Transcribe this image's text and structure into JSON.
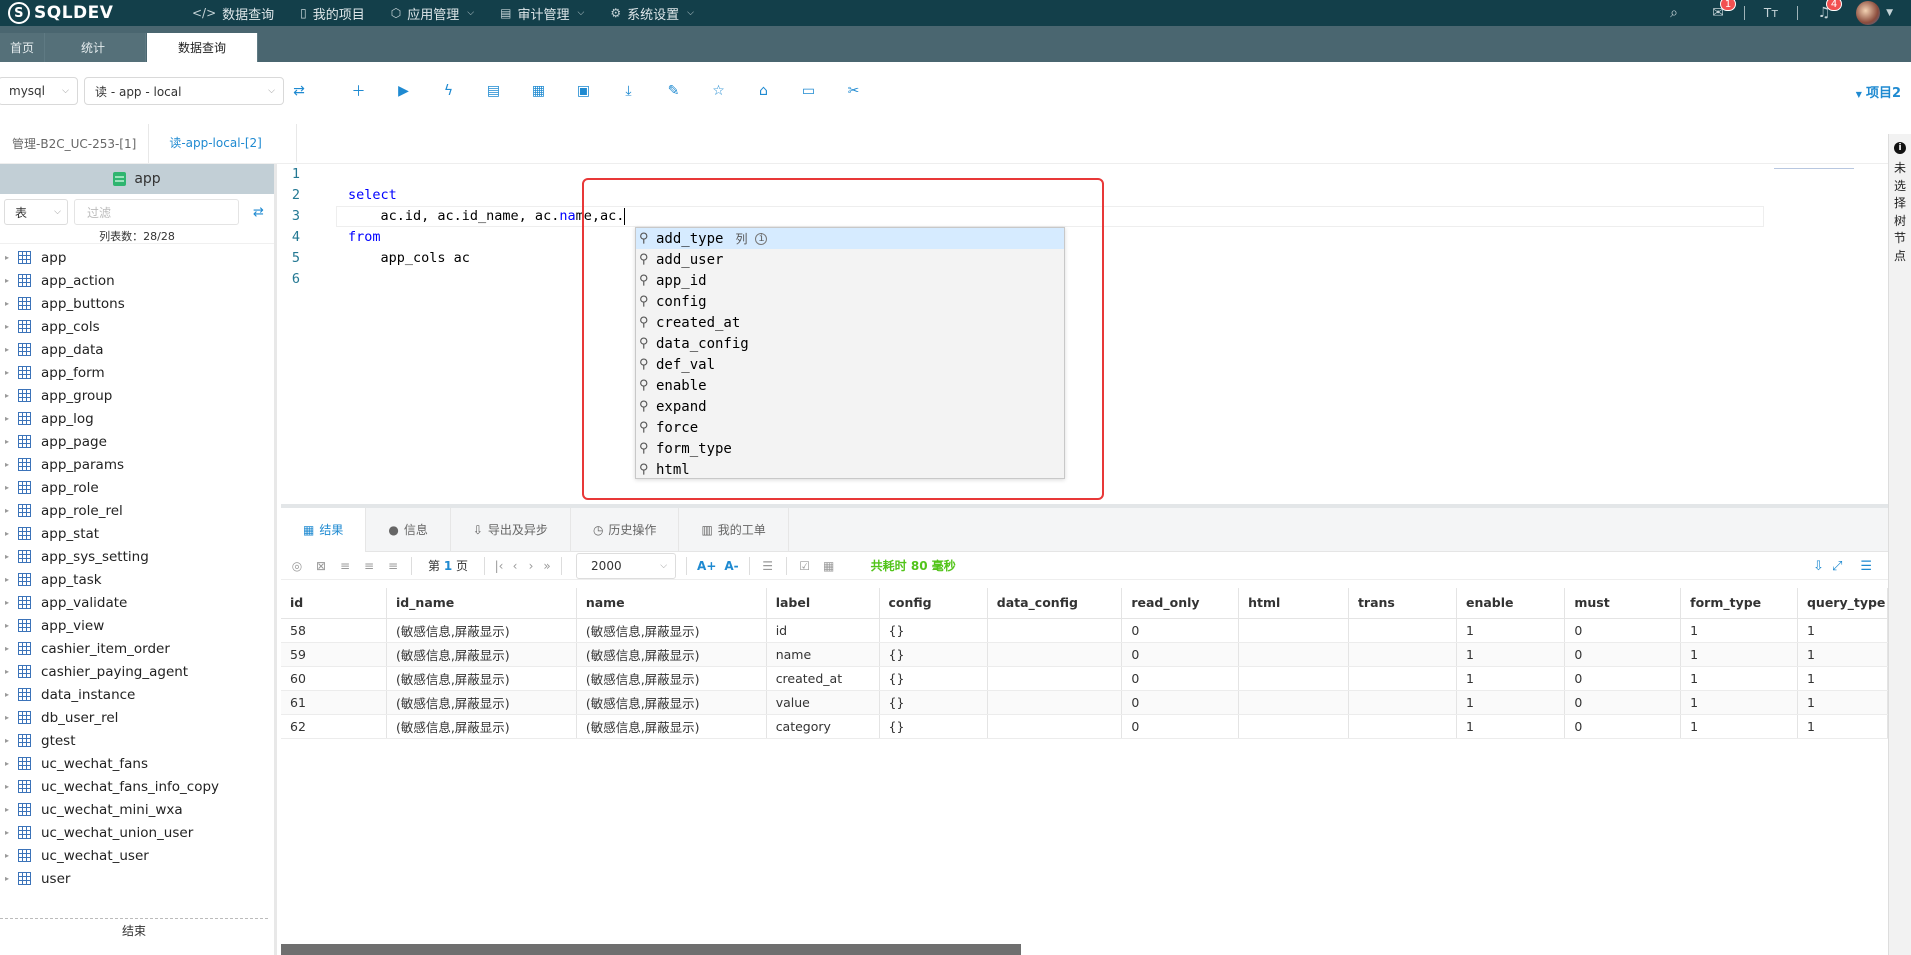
{
  "topnav": {
    "logo": "SQLDEV",
    "menu": [
      {
        "label": "数据查询",
        "icon": "code-icon",
        "dropdown": false
      },
      {
        "label": "我的项目",
        "icon": "book-icon",
        "dropdown": false
      },
      {
        "label": "应用管理",
        "icon": "cube-icon",
        "dropdown": true
      },
      {
        "label": "审计管理",
        "icon": "audit-icon",
        "dropdown": true
      },
      {
        "label": "系统设置",
        "icon": "gear-icon",
        "dropdown": true
      }
    ],
    "badges": {
      "messages": "1",
      "notices": "4"
    }
  },
  "pagetabs": [
    "首页",
    "统计",
    "数据查询"
  ],
  "toolbar": {
    "db_type": "mysql",
    "connection": "读 - app - local",
    "project_label": "项目2"
  },
  "editor_tabs": [
    "管理-B2C_UC-253-[1]",
    "读-app-local-[2]"
  ],
  "right_rail": {
    "text": "未选择树节点"
  },
  "sidebar": {
    "db_name": "app",
    "filter_type": "表",
    "filter_placeholder": "过滤",
    "count_text": "列表数：28/28",
    "tables": [
      "app",
      "app_action",
      "app_buttons",
      "app_cols",
      "app_data",
      "app_form",
      "app_group",
      "app_log",
      "app_page",
      "app_params",
      "app_role",
      "app_role_rel",
      "app_stat",
      "app_sys_setting",
      "app_task",
      "app_validate",
      "app_view",
      "cashier_item_order",
      "cashier_paying_agent",
      "data_instance",
      "db_user_rel",
      "gtest",
      "uc_wechat_fans",
      "uc_wechat_fans_info_copy",
      "uc_wechat_mini_wxa",
      "uc_wechat_union_user",
      "uc_wechat_user",
      "user"
    ],
    "end_text": "结束"
  },
  "editor": {
    "line_numbers": [
      "1",
      "2",
      "3",
      "4",
      "5",
      "6"
    ],
    "lines": {
      "l2_kw": "select",
      "l3_a": "    ac.id, ac.id_name, ac.",
      "l3_b": "na",
      "l3_c": "me,ac.",
      "l4_kw": "from",
      "l5": "    app_cols ac"
    }
  },
  "suggest": {
    "kind_label": "列",
    "items": [
      "add_type",
      "add_user",
      "app_id",
      "config",
      "created_at",
      "data_config",
      "def_val",
      "enable",
      "expand",
      "force",
      "form_type",
      "html"
    ]
  },
  "result_tabs": [
    "结果",
    "信息",
    "导出及异步",
    "历史操作",
    "我的工单"
  ],
  "result_toolbar": {
    "page_text_pre": "第",
    "page_num": "1",
    "page_text_post": "页",
    "page_size": "2000",
    "font_plus": "A+",
    "font_minus": "A-",
    "cost": "共耗时 80 毫秒"
  },
  "grid": {
    "columns": [
      "id",
      "id_name",
      "name",
      "label",
      "config",
      "data_config",
      "read_only",
      "html",
      "trans",
      "enable",
      "must",
      "form_type",
      "query_type"
    ],
    "rows": [
      [
        "58",
        "(敏感信息,屏蔽显示)",
        "(敏感信息,屏蔽显示)",
        "id",
        "{}",
        "",
        "0",
        "",
        "",
        "1",
        "0",
        "1",
        "1"
      ],
      [
        "59",
        "(敏感信息,屏蔽显示)",
        "(敏感信息,屏蔽显示)",
        "name",
        "{}",
        "",
        "0",
        "",
        "",
        "1",
        "0",
        "1",
        "1"
      ],
      [
        "60",
        "(敏感信息,屏蔽显示)",
        "(敏感信息,屏蔽显示)",
        "created_at",
        "{}",
        "",
        "0",
        "",
        "",
        "1",
        "0",
        "1",
        "1"
      ],
      [
        "61",
        "(敏感信息,屏蔽显示)",
        "(敏感信息,屏蔽显示)",
        "value",
        "{}",
        "",
        "0",
        "",
        "",
        "1",
        "0",
        "1",
        "1"
      ],
      [
        "62",
        "(敏感信息,屏蔽显示)",
        "(敏感信息,屏蔽显示)",
        "category",
        "{}",
        "",
        "0",
        "",
        "",
        "1",
        "0",
        "1",
        "1"
      ]
    ]
  },
  "colors": {
    "accent": "#1f8ad1",
    "nav_bg": "#133f4a",
    "highlight_box": "#e83838",
    "success": "#52c41a"
  }
}
